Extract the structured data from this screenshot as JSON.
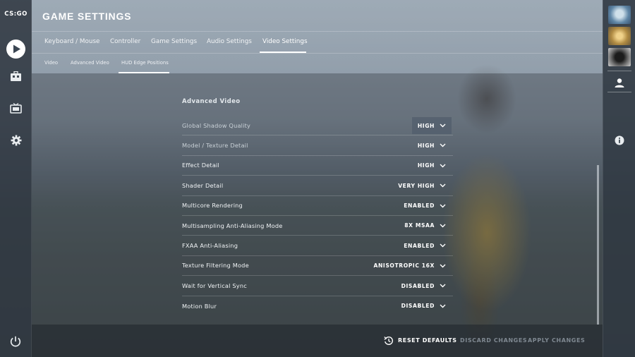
{
  "app": {
    "logo_text": "CS:GO",
    "title": "GAME SETTINGS"
  },
  "tabs": [
    {
      "label": "Keyboard / Mouse",
      "active": false
    },
    {
      "label": "Controller",
      "active": false
    },
    {
      "label": "Game Settings",
      "active": false
    },
    {
      "label": "Audio Settings",
      "active": false
    },
    {
      "label": "Video Settings",
      "active": true
    }
  ],
  "subtabs": [
    {
      "label": "Video",
      "active": false
    },
    {
      "label": "Advanced Video",
      "active": false
    },
    {
      "label": "HUD Edge Positions",
      "active": true
    }
  ],
  "section_title": "Advanced Video",
  "settings": [
    {
      "label": "Global Shadow Quality",
      "value": "HIGH"
    },
    {
      "label": "Model / Texture Detail",
      "value": "HIGH"
    },
    {
      "label": "Effect Detail",
      "value": "HIGH"
    },
    {
      "label": "Shader Detail",
      "value": "VERY HIGH"
    },
    {
      "label": "Multicore Rendering",
      "value": "ENABLED"
    },
    {
      "label": "Multisampling Anti-Aliasing Mode",
      "value": "8X MSAA"
    },
    {
      "label": "FXAA Anti-Aliasing",
      "value": "ENABLED"
    },
    {
      "label": "Texture Filtering Mode",
      "value": "ANISOTROPIC 16X"
    },
    {
      "label": "Wait for Vertical Sync",
      "value": "DISABLED"
    },
    {
      "label": "Motion Blur",
      "value": "DISABLED"
    }
  ],
  "footer": {
    "reset_label": "RESET DEFAULTS",
    "discard_label": "DISCARD CHANGES",
    "apply_label": "APPLY CHANGES"
  },
  "nav_left": {
    "icons": [
      "play-icon",
      "inventory-icon",
      "tv-icon",
      "gear-icon",
      "power-icon"
    ]
  },
  "nav_right": {
    "icons": [
      "avatar",
      "avatar",
      "avatar",
      "profile-icon",
      "info-icon"
    ]
  },
  "colors": {
    "text": "#ffffff",
    "disabled": "#7f8891",
    "panel": "#3e4854"
  }
}
